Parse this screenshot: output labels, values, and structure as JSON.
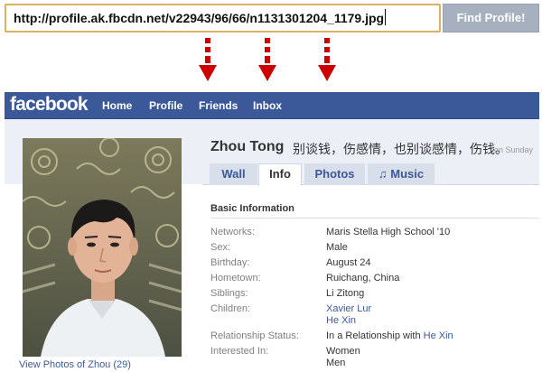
{
  "url_bar": {
    "value": "http://profile.ak.fbcdn.net/v22943/96/66/n1131301204_1179.jpg",
    "button_label": "Find Profile!"
  },
  "nav": {
    "logo": "facebook",
    "items": [
      "Home",
      "Profile",
      "Friends",
      "Inbox"
    ]
  },
  "profile": {
    "name": "Zhou Tong",
    "status": "别谈钱，伤感情，也别谈感情，伤钱。",
    "status_time": "on Sunday",
    "view_photos": "View Photos of Zhou (29)"
  },
  "tabs": [
    {
      "label": "Wall"
    },
    {
      "label": "Info"
    },
    {
      "label": "Photos"
    },
    {
      "label": "Music"
    }
  ],
  "info": {
    "section_title": "Basic Information",
    "networks_label": "Networks:",
    "networks_value": "Maris Stella High School '10",
    "sex_label": "Sex:",
    "sex_value": "Male",
    "birthday_label": "Birthday:",
    "birthday_value": "August 24",
    "hometown_label": "Hometown:",
    "hometown_value": "Ruichang, China",
    "siblings_label": "Siblings:",
    "siblings_value": "Li Zitong",
    "children_label": "Children:",
    "children_values": [
      "Xavier Lur",
      "He Xin"
    ],
    "relationship_label": "Relationship Status:",
    "relationship_prefix": "In a Relationship with",
    "relationship_partner": "He Xin",
    "interested_label": "Interested In:",
    "interested_values": [
      "Women",
      "Men"
    ]
  },
  "colors": {
    "brand": "#3b5998",
    "arrow": "#cc0000",
    "url_border": "#d8b25e",
    "button_bg": "#a7b0be"
  }
}
